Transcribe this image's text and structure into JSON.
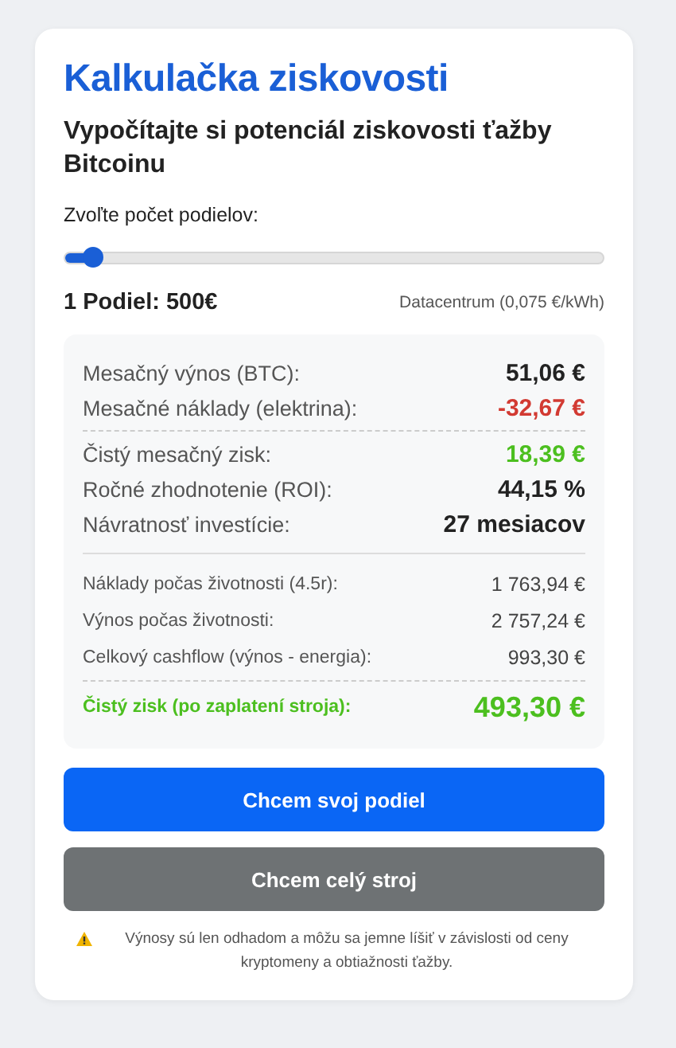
{
  "title": "Kalkulačka ziskovosti",
  "subtitle": "Vypočítajte si potenciál ziskovosti ťažby Bitcoinu",
  "slider": {
    "label": "Zvoľte počet podielov:",
    "level": 0.05
  },
  "share_price": "1 Podiel: 500€",
  "datacenter": "Datacentrum (0,075 €/kWh)",
  "sections": [
    {
      "kind": "main",
      "rule_above": false,
      "rows": [
        {
          "label": "Mesačný výnos (BTC):",
          "value": "51,06 €",
          "color": "#222222"
        },
        {
          "label": "Mesačné náklady (elektrina):",
          "value": "-32,67 €",
          "color": "#d23a32"
        }
      ]
    },
    {
      "kind": "main",
      "rule_above": true,
      "rows": [
        {
          "label": "Čistý mesačný zisk:",
          "value": "18,39 €",
          "color": "#4cbf1f"
        },
        {
          "label": "Ročné zhodnotenie (ROI):",
          "value": "44,15 %",
          "color": "#222222"
        },
        {
          "label": "Návratnosť investície:",
          "value": "27 mesiacov",
          "color": "#222222"
        }
      ]
    },
    {
      "kind": "detail",
      "rule_above": true,
      "rows": [
        {
          "label": "Náklady počas životnosti (4.5r):",
          "value": "1 763,94 €",
          "color": "#444444"
        },
        {
          "label": "Výnos počas životnosti:",
          "value": "2 757,24 €",
          "color": "#444444"
        },
        {
          "label": "Celkový cashflow (výnos - energia):",
          "value": "993,30 €",
          "color": "#444444"
        }
      ]
    },
    {
      "kind": "total",
      "rule_above": true,
      "rows": [
        {
          "label": "Čistý zisk (po zaplatení stroja):",
          "value": "493,30 €",
          "color": "#4cbf1f"
        }
      ]
    }
  ],
  "buttons": [
    {
      "label": "Chcem svoj podiel",
      "kind": "primary"
    },
    {
      "label": "Chcem celý stroj",
      "kind": "secondary"
    }
  ],
  "disclaimer": "Výnosy sú len odhadom a môžu sa jemne líšiť v závislosti od ceny kryptomeny a obtiažnosti ťažby."
}
